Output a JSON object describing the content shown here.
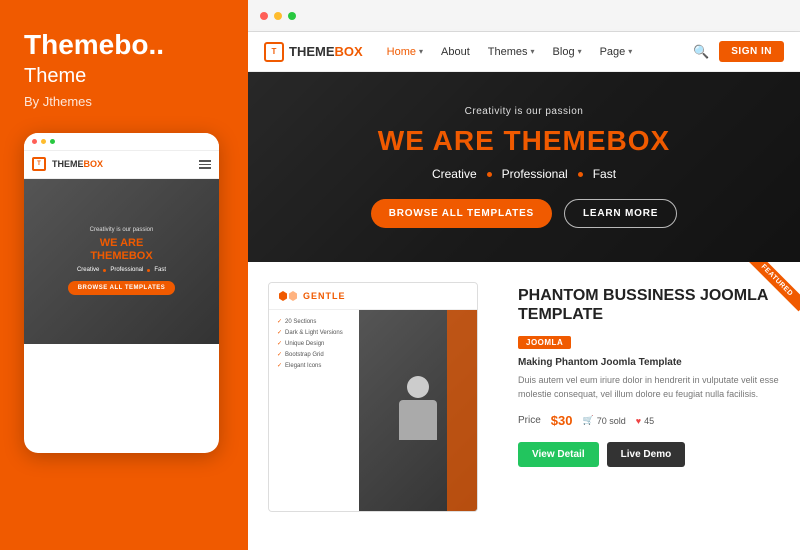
{
  "left": {
    "title": "Themebo..",
    "subtitle": "Theme",
    "author": "By Jthemes",
    "mobile_dots": [
      "red",
      "yellow",
      "green"
    ],
    "mobile_tagline": "Creativity is our passion",
    "mobile_headline_pre": "WE ARE",
    "mobile_headline_brand_pre": "THEME",
    "mobile_headline_brand_suf": "BOX",
    "mobile_subline": [
      "Creative",
      "Professional",
      "Fast"
    ],
    "mobile_cta": "BROWSE ALL TEMPLATES"
  },
  "browser": {
    "dots": [
      "red",
      "yellow",
      "green"
    ]
  },
  "nav": {
    "logo_pre": "THEME",
    "logo_suf": "BOX",
    "items": [
      {
        "label": "Home",
        "has_arrow": true,
        "active": true
      },
      {
        "label": "About",
        "has_arrow": false,
        "active": false
      },
      {
        "label": "Themes",
        "has_arrow": true,
        "active": false
      },
      {
        "label": "Blog",
        "has_arrow": true,
        "active": false
      },
      {
        "label": "Page",
        "has_arrow": true,
        "active": false
      }
    ],
    "sign_in": "SIGN IN"
  },
  "hero": {
    "tagline": "Creativity is our passion",
    "headline_pre": "WE ARE ",
    "headline_brand": "THEMEBOX",
    "subline": [
      "Creative",
      "Professional",
      "Fast"
    ],
    "btn_browse": "BROWSE ALL TEMPLATES",
    "btn_learn": "LEARN MORE"
  },
  "product": {
    "ribbon": "FEATURED",
    "gentle_label": "GENTLE",
    "gentle_features": [
      "20 Sections",
      "Dark & Light Versions",
      "Unique Design",
      "Bootstrap Grid",
      "Elegant Icons"
    ],
    "title": "PHANTOM BUSSINESS JOOMLA TEMPLATE",
    "badge": "JOOMLA",
    "subtitle": "Making Phantom Joomla Template",
    "desc": "Duis autem vel eum iriure dolor in hendrerit in vulputate velit esse molestie consequat, vel illum dolore eu feugiat nulla facilisis.",
    "price_label": "Price",
    "price_value": "$30",
    "sold_count": "70 sold",
    "likes_count": "45",
    "btn_detail": "View Detail",
    "btn_demo": "Live Demo"
  }
}
